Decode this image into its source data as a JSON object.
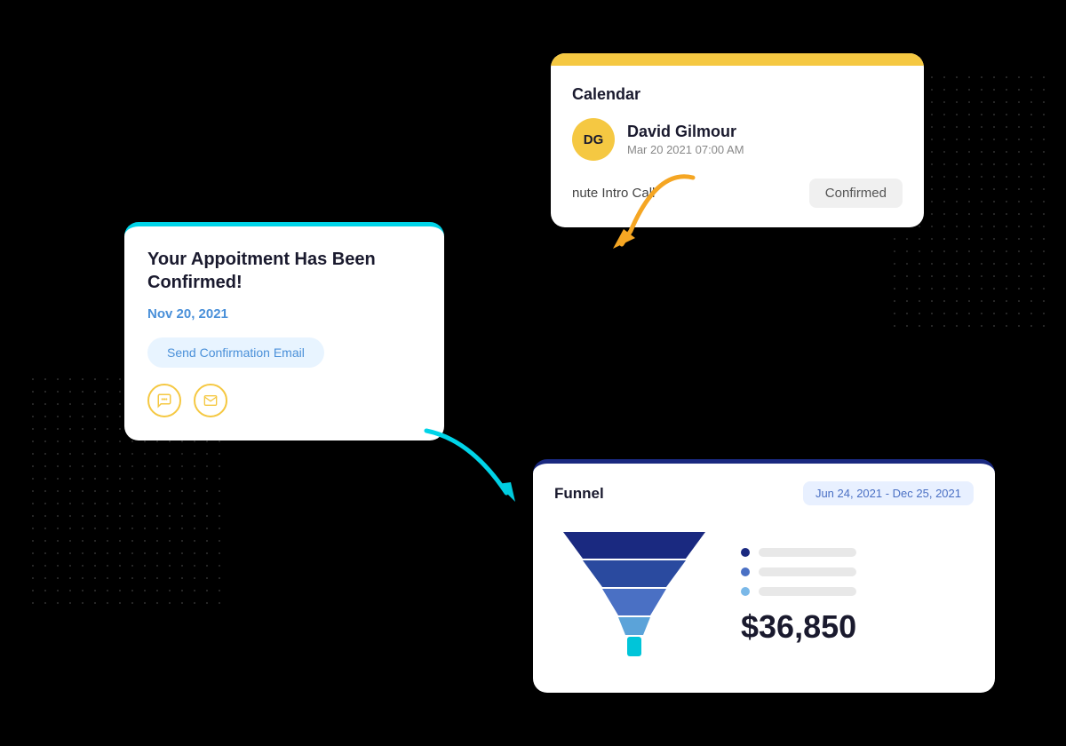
{
  "background": "#000000",
  "calendar": {
    "title": "Calendar",
    "contact": {
      "initials": "DG",
      "name": "David Gilmour",
      "date": "Mar 20 2021  07:00 AM"
    },
    "event": "nute Intro Call",
    "status": "Confirmed"
  },
  "appointment": {
    "title": "Your Appoitment Has Been Confirmed!",
    "date": "Nov 20, 2021",
    "button": "Send Confirmation Email",
    "icons": [
      "chat-icon",
      "mail-icon"
    ]
  },
  "funnel": {
    "title": "Funnel",
    "date_range": "Jun 24, 2021 - Dec 25, 2021",
    "amount": "$36,850",
    "legend": [
      {
        "color": "#4a70c4",
        "bar_width": "80%"
      },
      {
        "color": "#4a90d9",
        "bar_width": "60%"
      },
      {
        "color": "#7ab8e8",
        "bar_width": "40%"
      }
    ]
  }
}
